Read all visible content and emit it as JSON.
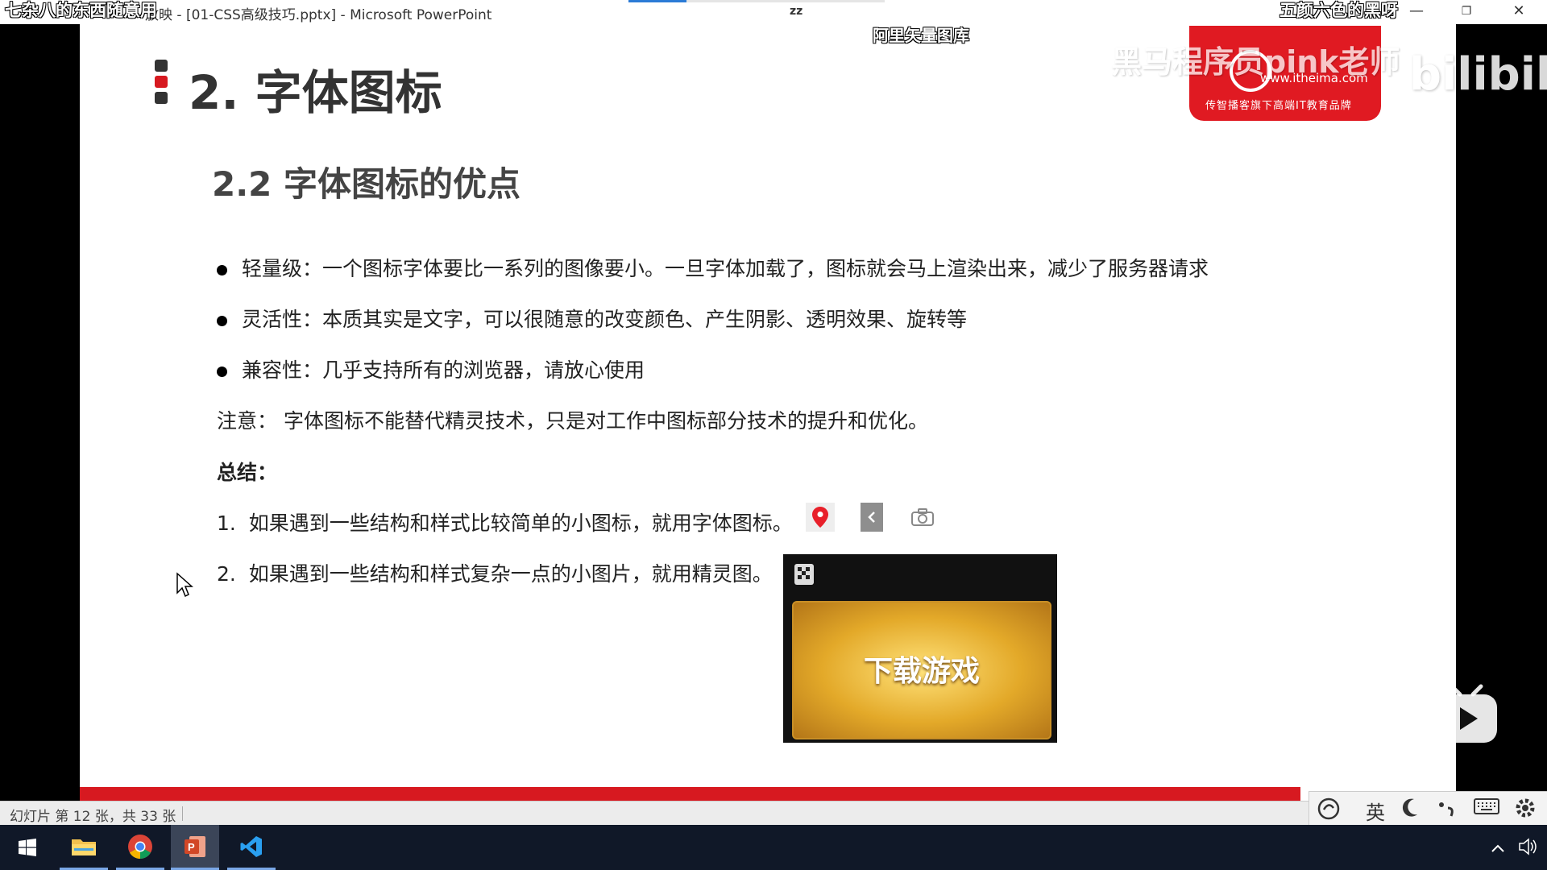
{
  "titlebar": {
    "left_overlay": "七杂八的东西随意用",
    "window_title": "放映 - [01-CSS高级技巧.pptx] - Microsoft PowerPoint",
    "zz_icon": "zz",
    "right_overlay": "五颜六色的黑呀",
    "minimize": "—",
    "restore": "❐",
    "close": "✕"
  },
  "overlay": {
    "ali_label": "阿里矢量图库",
    "watermark": "黑马程序员pink老师",
    "bilibili": "bilibili"
  },
  "logo": {
    "url": "www.itheima.com",
    "tagline": "传智播客旗下高端IT教育品牌"
  },
  "slide": {
    "title": "2. 字体图标",
    "subtitle": "2.2 字体图标的优点",
    "bullets": [
      "轻量级：一个图标字体要比一系列的图像要小。一旦字体加载了，图标就会马上渲染出来，减少了服务器请求",
      "灵活性：本质其实是文字，可以很随意的改变颜色、产生阴影、透明效果、旋转等",
      "兼容性：几乎支持所有的浏览器，请放心使用"
    ],
    "note": "注意： 字体图标不能替代精灵技术，只是对工作中图标部分技术的提升和优化。",
    "summary_label": "总结：",
    "summary_items": [
      {
        "num": "1.",
        "text": "如果遇到一些结构和样式比较简单的小图标，就用字体图标。"
      },
      {
        "num": "2.",
        "text": "如果遇到一些结构和样式复杂一点的小图片，就用精灵图。"
      }
    ],
    "sprite_text": "下载游戏",
    "example_icons": [
      "location-pin-icon",
      "chevron-left-icon",
      "camera-icon"
    ]
  },
  "statusbar": {
    "slide_info": "幻灯片 第 12 张，共 33 张"
  },
  "ime": {
    "lang": "英",
    "items": [
      "ime-logo-icon",
      "moon-icon",
      "punctuation-icon",
      "keyboard-icon",
      "gear-icon"
    ]
  },
  "taskbar": {
    "apps": [
      "windows-start-icon",
      "file-explorer-icon",
      "chrome-icon",
      "powerpoint-icon",
      "vscode-icon"
    ]
  },
  "colors": {
    "accent_red": "#d71920",
    "title_text": "#333333",
    "taskbar_bg": "#101828"
  }
}
